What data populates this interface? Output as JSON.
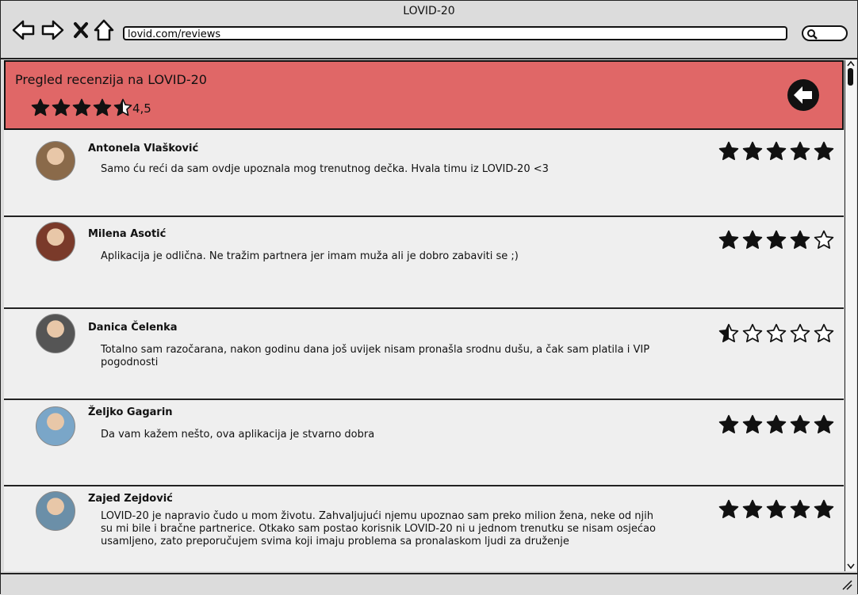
{
  "browser": {
    "title": "LOVID-20",
    "url": "lovid.com/reviews"
  },
  "header": {
    "title": "Pregled recenzija na LOVID-20",
    "rating_value": 4.5,
    "rating_text": "4,5"
  },
  "reviews": [
    {
      "name": "Antonela Vlašković",
      "text": "Samo ću reći da sam ovdje upoznala mog trenutnog dečka. Hvala timu iz LOVID-20 <3",
      "rating": 5,
      "avatar_color": "#8a6a4a"
    },
    {
      "name": "Milena Asotić",
      "text": "Aplikacija je odlična. Ne tražim partnera jer imam muža ali je dobro zabaviti se ;)",
      "rating": 4,
      "avatar_color": "#7a3a2a"
    },
    {
      "name": "Danica Čelenka",
      "text": "Totalno sam razočarana, nakon godinu dana još uvijek nisam pronašla srodnu dušu, a čak sam platila i VIP pogodnosti",
      "rating": 0.5,
      "avatar_color": "#555555"
    },
    {
      "name": "Željko Gagarin",
      "text": "Da vam kažem nešto, ova aplikacija je stvarno dobra",
      "rating": 5,
      "avatar_color": "#7aa6c8"
    },
    {
      "name": "Zajed Zejdović",
      "text": "LOVID-20 je napravio čudo u mom životu. Zahvaljujući njemu upoznao sam preko milion žena, neke od njih su mi bile i bračne partnerice. Otkako sam postao korisnik LOVID-20 ni u jednom trenutku se nisam osjećao usamljeno, zato preporučujem svima koji imaju problema sa pronalaskom ljudi za druženje",
      "rating": 5,
      "avatar_color": "#6b8fa8"
    }
  ],
  "icons": {
    "back_nav": "arrow-left-icon",
    "forward_nav": "arrow-right-icon",
    "close_nav": "close-icon",
    "home_nav": "home-icon",
    "search": "search-icon",
    "header_back": "circle-arrow-left-icon",
    "star": "star-icon"
  },
  "colors": {
    "header_bg": "#e06767",
    "content_bg": "#efefef",
    "chrome_bg": "#dcdcdc"
  }
}
